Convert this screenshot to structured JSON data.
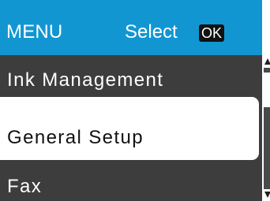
{
  "header": {
    "title": "MENU",
    "select_label": "Select",
    "ok_label": "OK"
  },
  "menu": {
    "items": [
      {
        "label": "Ink Management"
      },
      {
        "label": "General Setup",
        "selected": true
      },
      {
        "label": "Fax"
      }
    ]
  },
  "colors": {
    "header_bg": "#1296d2",
    "screen_bg": "#3d3d3d",
    "highlight_bg": "#ffffff",
    "text_light": "#ffffff",
    "text_dark": "#111111"
  },
  "icons": {
    "ok_badge": "ok-key-icon",
    "scroll_up": "scroll-up-arrow-icon",
    "scroll_down": "scroll-down-arrow-icon"
  }
}
